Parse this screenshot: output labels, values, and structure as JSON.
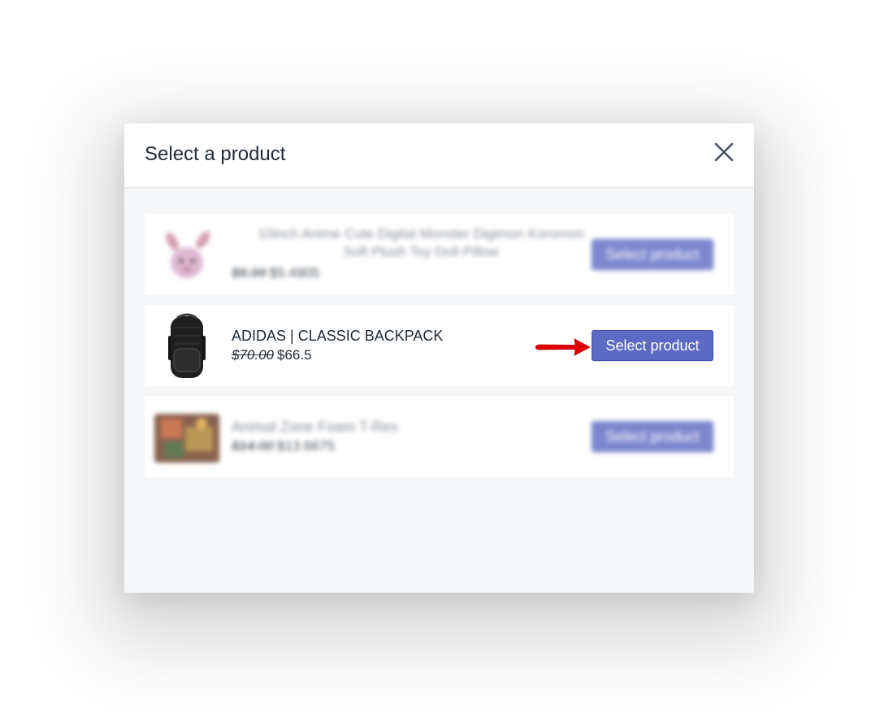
{
  "modal": {
    "title": "Select a product"
  },
  "products": [
    {
      "name": "10inch Anime Cute Digital Monster Digimon Koromon Soft Plush Toy Doll Pillow",
      "old_price": "$6.99",
      "price": "$5.4905",
      "button_label": "Select product",
      "blurred": true
    },
    {
      "name": "ADIDAS | CLASSIC BACKPACK",
      "old_price": "$70.00",
      "price": "$66.5",
      "button_label": "Select product",
      "blurred": false
    },
    {
      "name": "Animal Zone Foam T-Rex",
      "old_price": "$14.00",
      "price": "$13.6675",
      "button_label": "Select product",
      "blurred": true
    }
  ],
  "colors": {
    "primary_button": "#5c6ac4",
    "annotation_arrow": "#e00000",
    "modal_body": "#f4f6f8"
  },
  "icons": {
    "close": "close-icon",
    "annotation": "arrow-right-icon"
  }
}
